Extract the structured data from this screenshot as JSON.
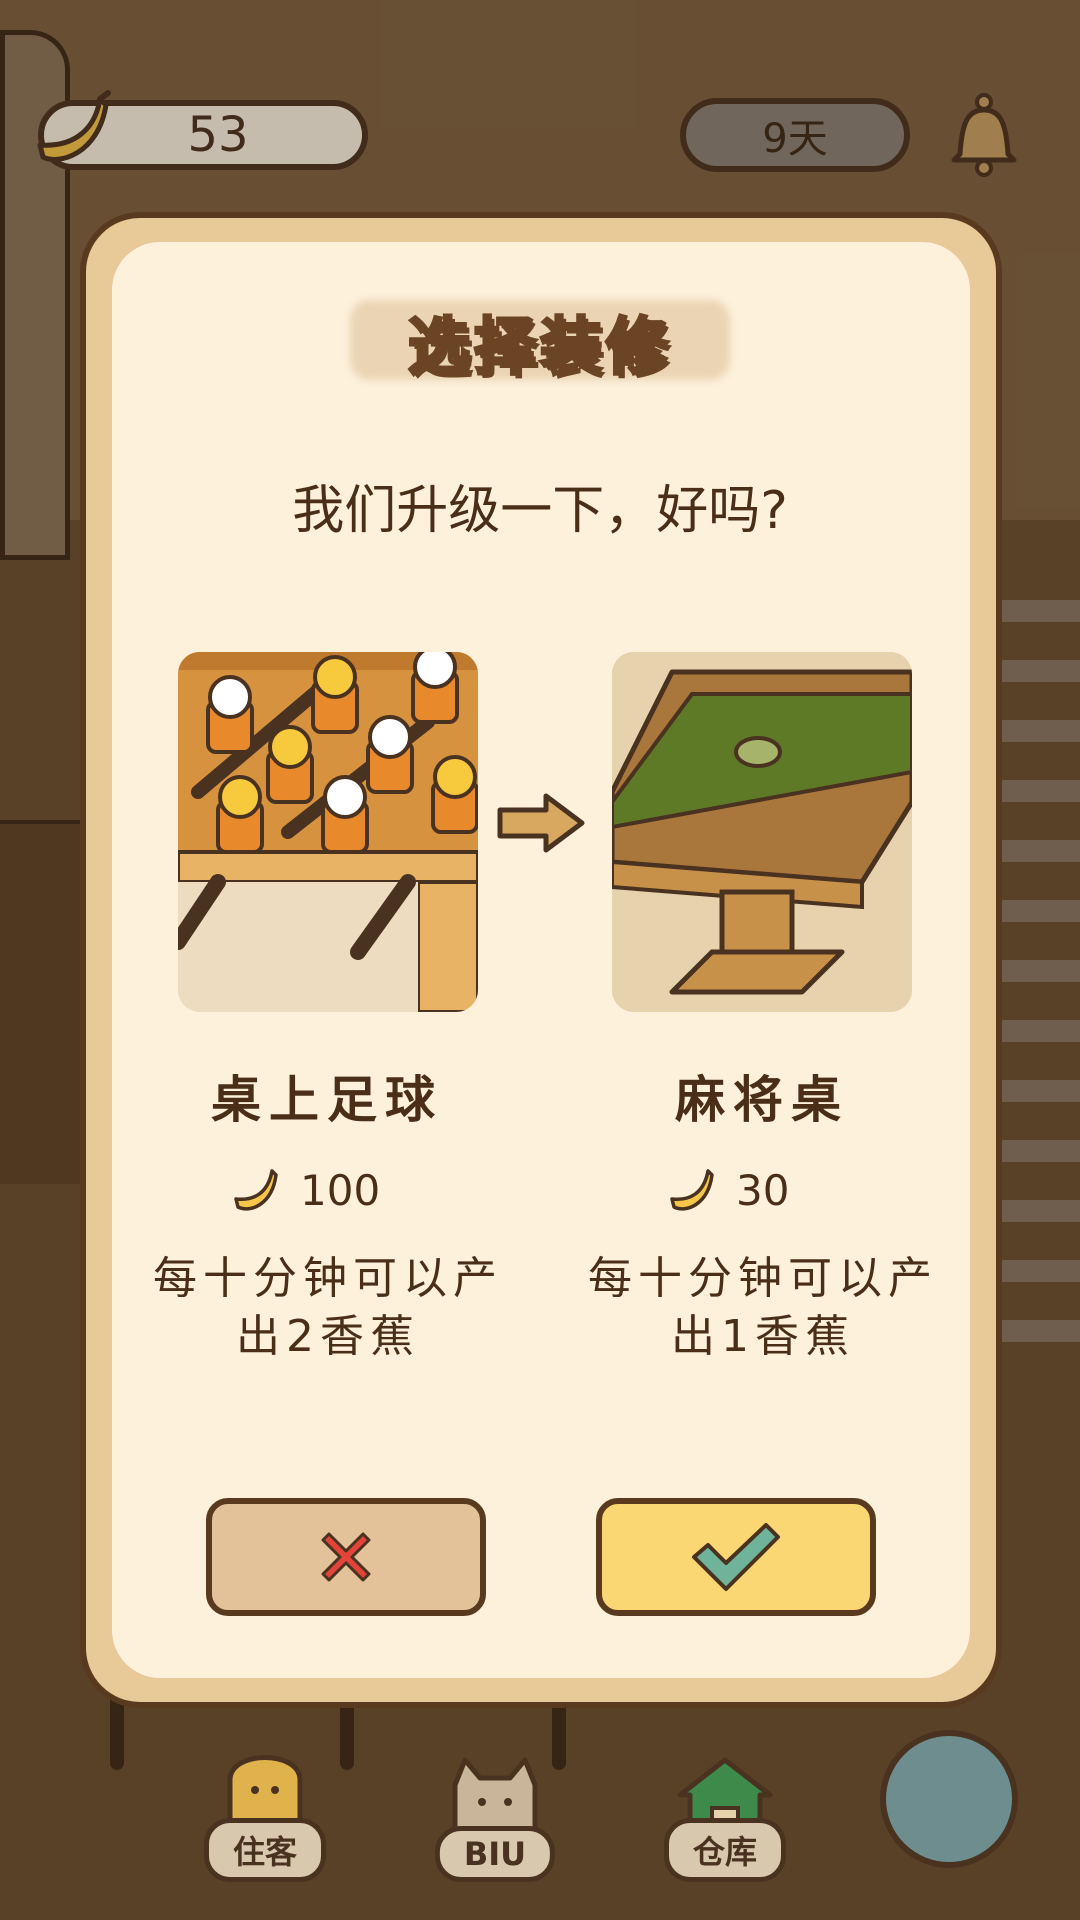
{
  "hud": {
    "banana_count": "53",
    "days": "9天",
    "icons": [
      "banana-icon",
      "bell-icon"
    ]
  },
  "modal": {
    "title": "选择装修",
    "question": "我们升级一下，好吗?",
    "from_item": {
      "name": "桌上足球",
      "price": "100",
      "description": "每十分钟可以产出2香蕉"
    },
    "to_item": {
      "name": "麻将桌",
      "price": "30",
      "description": "每十分钟可以产出1香蕉"
    },
    "cancel_icon": "close-x-icon",
    "confirm_icon": "checkmark-icon"
  },
  "nav": {
    "items": [
      {
        "label": "住客",
        "icon": "banana-guest-icon"
      },
      {
        "label": "BIU",
        "icon": "cat-face-icon"
      },
      {
        "label": "仓库",
        "icon": "house-icon"
      }
    ],
    "extra_icon": "yarn-ball-icon"
  },
  "colors": {
    "panel_bg": "#fdf1dc",
    "panel_border": "#e8c998",
    "confirm": "#fbd774",
    "cancel": "#e3c29a",
    "text": "#4a2e18"
  }
}
